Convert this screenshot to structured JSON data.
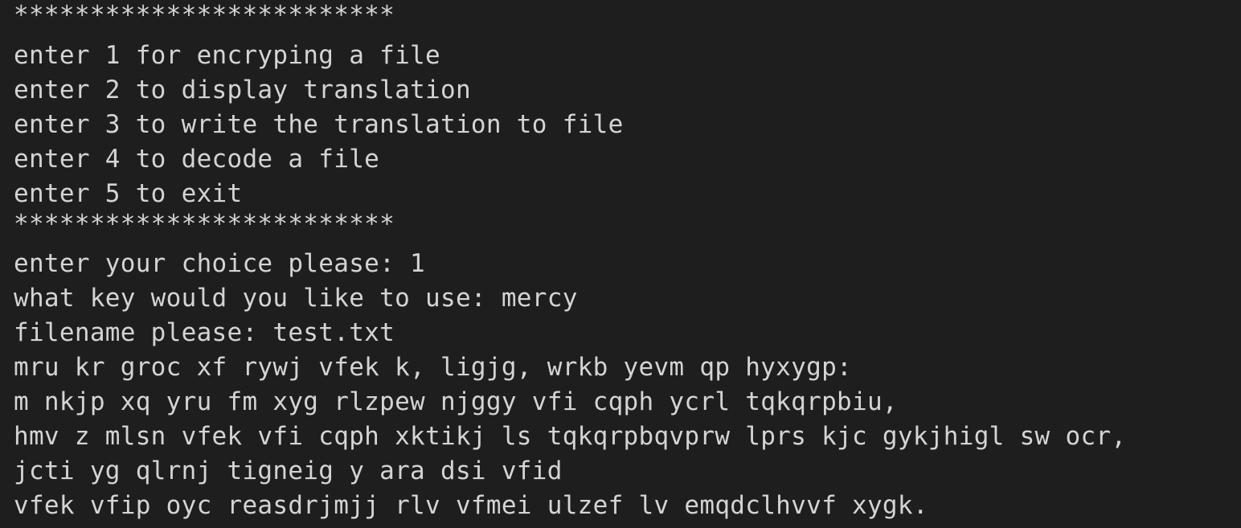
{
  "terminal": {
    "background": "#1e1e1e",
    "foreground": "#d4d4d4",
    "lines": [
      "*************************",
      "enter 1 for encryping a file",
      "enter 2 to display translation",
      "enter 3 to write the translation to file",
      "enter 4 to decode a file",
      "enter 5 to exit",
      "*************************",
      "enter your choice please: 1",
      "what key would you like to use: mercy",
      "filename please: test.txt",
      "mru kr groc xf rywj vfek k, ligjg, wrkb yevm qp hyxygp:",
      "m nkjp xq yru fm xyg rlzpew njggy vfi cqph ycrl tqkqrpbiu,",
      "hmv z mlsn vfek vfi cqph xktikj ls tqkqrpbqvprw lprs kjc gykjhigl sw ocr,",
      "jcti yg qlrnj tigneig y ara dsi vfid",
      "vfek vfip oyc reasdrjmjj rlv vfmei ulzef lv emqdclhvvf xygk."
    ]
  }
}
